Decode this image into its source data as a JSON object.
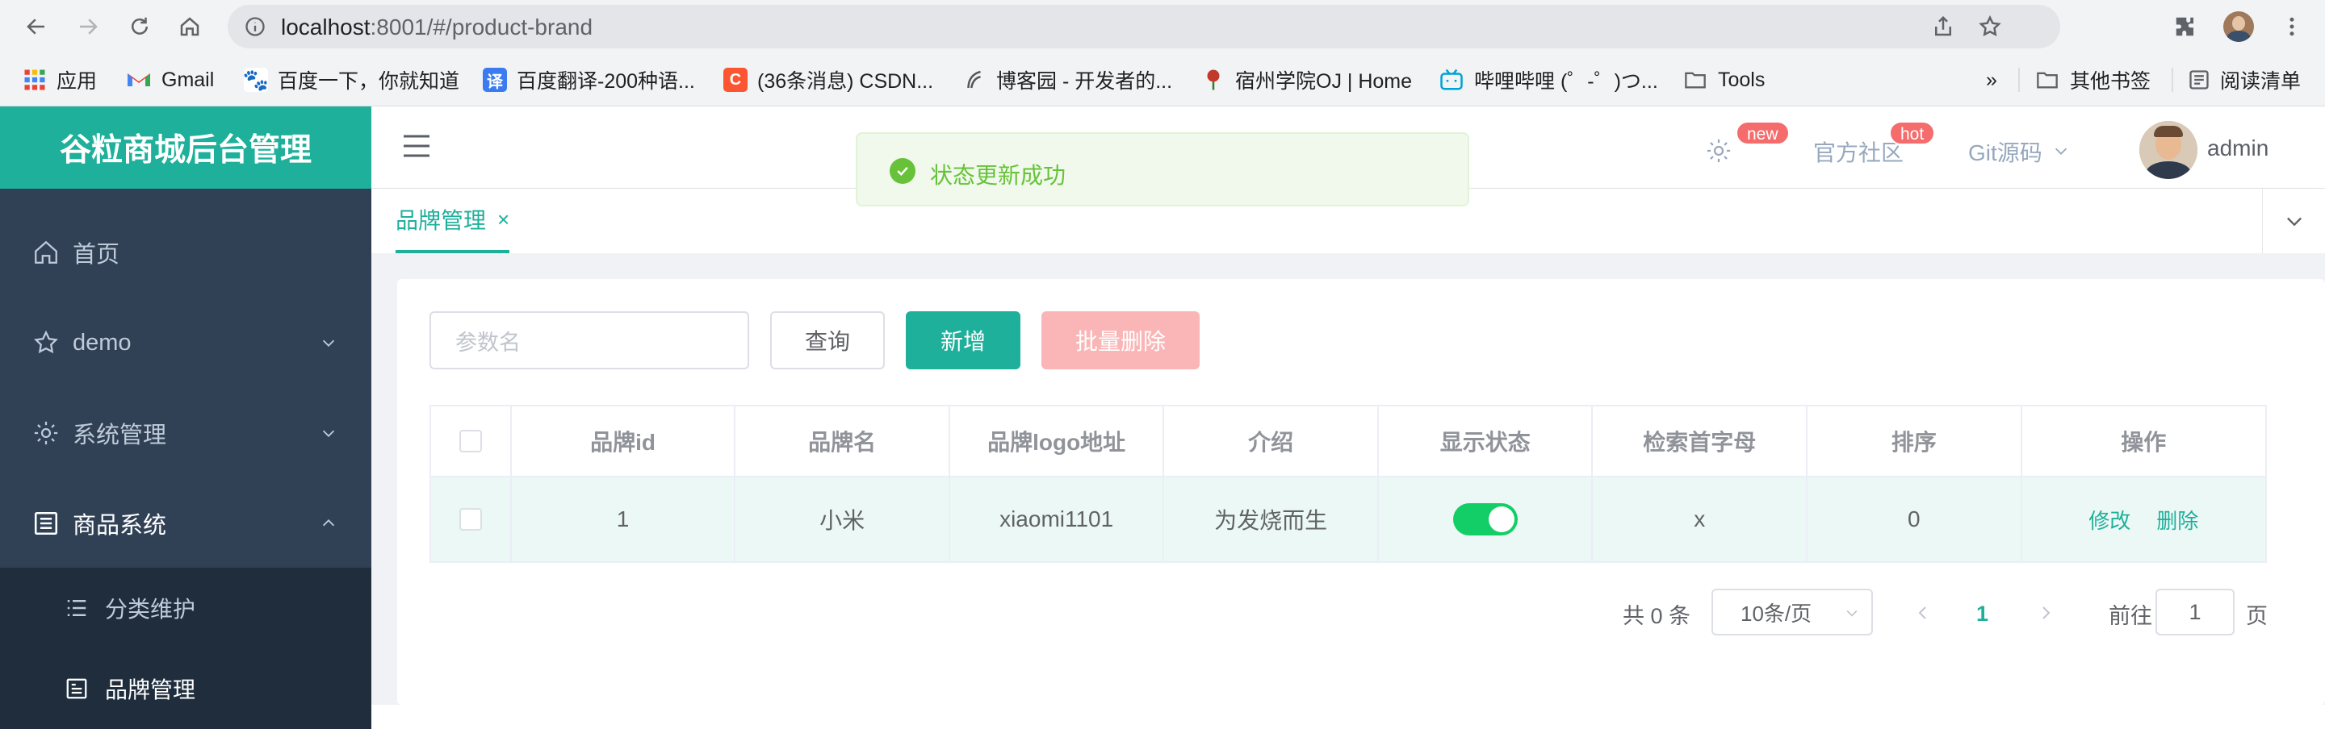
{
  "browser": {
    "url_host": "localhost",
    "url_rest": ":8001/#/product-brand",
    "bookmarks": [
      {
        "label": "应用",
        "icon": "apps-grid-icon",
        "color": "#4285f4"
      },
      {
        "label": "Gmail",
        "icon": "gmail-icon",
        "color": "#ea4335"
      },
      {
        "label": "百度一下，你就知道",
        "icon": "baidu-icon",
        "color": "#2932e1"
      },
      {
        "label": "百度翻译-200种语...",
        "icon": "baidu-translate-icon",
        "color": "#3a7bf2"
      },
      {
        "label": "(36条消息) CSDN...",
        "icon": "csdn-icon",
        "color": "#fc5531"
      },
      {
        "label": "博客园 - 开发者的...",
        "icon": "cnblogs-icon",
        "color": "#555555"
      },
      {
        "label": "宿州学院OJ | Home",
        "icon": "oj-icon",
        "color": "#c0392b"
      },
      {
        "label": "哔哩哔哩 (゜-゜)つ...",
        "icon": "bilibili-icon",
        "color": "#00a1d6"
      },
      {
        "label": "Tools",
        "icon": "folder-icon",
        "color": "#5f6368"
      }
    ],
    "overflow": "»",
    "other_bookmarks": "其他书签",
    "reading_list": "阅读清单"
  },
  "sidebar": {
    "title": "谷粒商城后台管理",
    "items": [
      {
        "label": "首页",
        "icon": "home-icon"
      },
      {
        "label": "demo",
        "icon": "star-icon"
      },
      {
        "label": "系统管理",
        "icon": "gear-icon"
      },
      {
        "label": "商品系统",
        "icon": "list-icon"
      }
    ],
    "sub_items": [
      {
        "label": "分类维护",
        "icon": "tree-list-icon"
      },
      {
        "label": "品牌管理",
        "icon": "document-icon"
      }
    ]
  },
  "header": {
    "settings_badge": "new",
    "community": "官方社区",
    "community_badge": "hot",
    "git": "Git源码",
    "user": "admin"
  },
  "tags": {
    "active": "品牌管理",
    "close": "×"
  },
  "toolbar": {
    "search_placeholder": "参数名",
    "query": "查询",
    "add": "新增",
    "batch_delete": "批量删除"
  },
  "table": {
    "columns": [
      "品牌id",
      "品牌名",
      "品牌logo地址",
      "介绍",
      "显示状态",
      "检索首字母",
      "排序",
      "操作"
    ],
    "rows": [
      {
        "id": "1",
        "name": "小米",
        "logo": "xiaomi1101",
        "desc": "为发烧而生",
        "status": true,
        "letter": "x",
        "sort": "0"
      }
    ],
    "edit": "修改",
    "delete": "删除"
  },
  "pagination": {
    "total": "共 0 条",
    "page_size": "10条/页",
    "current": "1",
    "goto_label": "前往",
    "goto_value": "1",
    "page_unit": "页"
  },
  "toast": {
    "message": "状态更新成功"
  },
  "colors": {
    "primary": "#1eb09a",
    "sidebar": "#304156",
    "success": "#67c23a",
    "switch_on": "#13ce66"
  }
}
